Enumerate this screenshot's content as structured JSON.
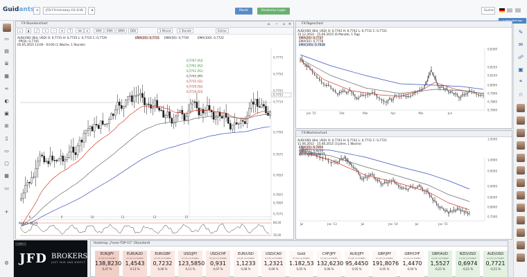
{
  "topbar": {
    "logo_main": "Guid",
    "logo_accent": "ants",
    "tab_title": "JFD-FX-Intraday-H1-D-W",
    "btn_market": "Markt",
    "btn_login": "Kostenlos Login",
    "search": "Suche"
  },
  "chart1": {
    "title": "FX-Stundenchart",
    "toolbar": [
      "SMA",
      "EMA",
      "WMA",
      "DBV",
      "1 Monat",
      "1 Stunde",
      "Extras"
    ],
    "info": "AUD/USD (Bid, USD)  O: 0,7731  H: 0,7735  L: 0,7725  C: 0,7729",
    "info2": "PP(D): 0,7745",
    "info3": "05.05.2015 13:00 - 03:00 (1 Woche, 1 Stunde)",
    "ema20": "EMA(20): 0,7731",
    "ema50": "EMA(50): 0,7730",
    "ema100": "EMA(100): 0,7722",
    "pivots": [
      "0,7767 (R3)",
      "0,7761 (R2)",
      "0,7751 (R1)",
      "0,7745 (PP)",
      "0,7735 (S1)",
      "0,7729 (S2)",
      "0,7719 (S3)"
    ],
    "y_ticks": [
      "0,7775",
      "0,7750",
      "0,7725",
      "0,7714",
      "0,7700",
      "0,7675",
      "0,7650",
      "0,7625",
      "0,7600",
      "0,7575"
    ],
    "x_ticks": [
      "8",
      "9",
      "10",
      "11",
      "12",
      "15"
    ],
    "last_price": "0,7733",
    "rsi_label": "RSI(7): 48,15",
    "rsi_levels": [
      "80,00",
      "20,00"
    ]
  },
  "chart2": {
    "title": "FX-Tageschart",
    "info": "AUD/USD (Bid, USD)  O: 0,7742  H: 0,7742  L: 0,7731  C: 0,7721",
    "info2": "15.12.2014 - 15.06.2015 (6 Monate, 1 Tag)",
    "ema20": "EMA(20): 0,7737",
    "ema50": "EMA(50): 0,7778",
    "ema100": "EMA(100): 0,7838",
    "y_ticks": [
      "0,8300",
      "0,8250",
      "0,8100",
      "0,8000",
      "0,7900",
      "0,7800",
      "0,7600"
    ],
    "x_ticks": [
      "Jan '15",
      "Feb",
      "Mar",
      "Apr",
      "Mai",
      "Jun"
    ]
  },
  "chart3": {
    "title": "FX-Wochenchart",
    "info": "AUD/USD (Bid, USD)  O: 0,7742  H: 0,7742  L: 0,7731  C: 0,7721",
    "info2": "11.06.2012 - 15.06.2015 (3 Jahre, 1 Woche)",
    "ema20": "EMA(20): 0,7850",
    "ema50": "EMA(50): 0,8226",
    "ema100": "EMA(100): 0,8677",
    "y_ticks": [
      "1,0500",
      "1,0000",
      "0,9500",
      "0,9000",
      "0,8500",
      "0,8000",
      "0,7500"
    ],
    "x_ticks": [
      "Jul",
      "Jan '13",
      "Jul",
      "Jan '14",
      "Jul",
      "Jan '15"
    ]
  },
  "rightbar": {
    "new_btn": "+ neue Beiträge"
  },
  "jfd": {
    "small": "JFD",
    "big": "JFD",
    "brokers": "BROKERS",
    "tagline": "JUST FAIR AND DIRECT"
  },
  "heatmap": {
    "title": "Heatmap „Forex-TOP-15\" (Standard)",
    "cells": [
      {
        "name": "EUR/JPY",
        "date": "07.05 14 FOREX",
        "value": "138,8230",
        "pct": "0,47 %"
      },
      {
        "name": "EUR/AUD",
        "date": "07.05 14 FOREX",
        "value": "1,4543",
        "pct": "0,13 %"
      },
      {
        "name": "EUR/GBP",
        "date": "07.05 14 FOREX",
        "value": "0,7232",
        "pct": "0,06 %"
      },
      {
        "name": "USD/JPY",
        "date": "07.05 14 FOREX",
        "value": "123,5850",
        "pct": "0,11 %"
      },
      {
        "name": "USD/CHF",
        "date": "07.05 14 FOREX",
        "value": "0,931",
        "pct": "0,07 %"
      },
      {
        "name": "EUR/USD",
        "date": "07.05 14 FOREX",
        "value": "1,1233",
        "pct": "0,08 %"
      },
      {
        "name": "USD/CAD",
        "date": "07.05 14 FOREX",
        "value": "1,2321",
        "pct": "0,06 %"
      },
      {
        "name": "Gold",
        "date": "07.05 14 FOREX",
        "value": "1.182,53",
        "pct": "0,05 %"
      },
      {
        "name": "CHF/JPY",
        "date": "07.05 14 FOREX",
        "value": "132,6230",
        "pct": "0,06 %"
      },
      {
        "name": "AUD/JPY",
        "date": "07.05 14 FOREX",
        "value": "95,4450",
        "pct": "0,05 %"
      },
      {
        "name": "GBP/JPY",
        "date": "07.05 14 FOREX",
        "value": "191,8076",
        "pct": "0,05 %"
      },
      {
        "name": "GBP/CHF",
        "date": "07.05 14 FOREX",
        "value": "1,4470",
        "pct": "0,04 %"
      },
      {
        "name": "GBP/AUD",
        "date": "07.05 14 FOREX",
        "value": "1,5527",
        "pct": "-0,21 %"
      },
      {
        "name": "NZD/USD",
        "date": "07.05 14 FOREX",
        "value": "0,6974",
        "pct": "-0,21 %"
      },
      {
        "name": "AUD/USD",
        "date": "07.05 14 FOREX",
        "value": "0,7721",
        "pct": "-0,21 %"
      }
    ],
    "colors": [
      "#f2cfc6",
      "#f7dcd5",
      "#fbe7e2",
      "#fbe9e5",
      "#fbe9e5",
      "#fdf3f1",
      "#fdf3f1",
      "#fef6f4",
      "#fef6f4",
      "#fef6f4",
      "#fef6f4",
      "#fff8f6",
      "#e3f1e1",
      "#e3f1e1",
      "#e3f1e1"
    ]
  },
  "colors": {
    "ema20": "#d33b2c",
    "ema50": "#6b6b6b",
    "ema100": "#3a4fb8",
    "candle": "#1a1a1a",
    "line": "#222"
  }
}
